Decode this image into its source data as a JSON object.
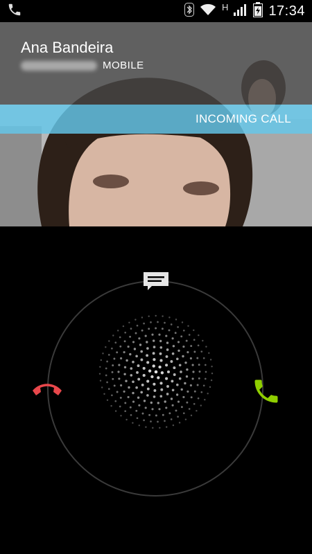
{
  "status_bar": {
    "time": "17:34",
    "network_type": "H",
    "icons": [
      "phone-notification-icon",
      "bluetooth-icon",
      "wifi-icon",
      "signal-icon",
      "battery-icon"
    ]
  },
  "contact": {
    "name": "Ana Bandeira",
    "number_label": "MOBILE"
  },
  "call_state": "INCOMING CALL",
  "colors": {
    "incoming_bar": "#64c8eb",
    "decline": "#e8474b",
    "answer": "#8fce00",
    "ring": "#3a3a3a"
  },
  "actions": [
    "decline-call",
    "answer-call",
    "reply-with-message"
  ]
}
